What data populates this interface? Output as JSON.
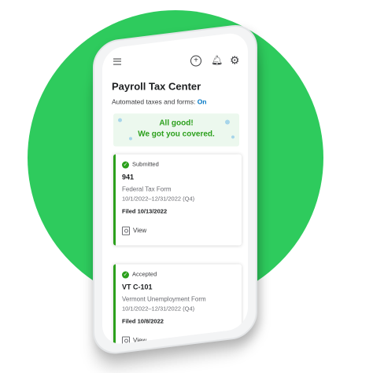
{
  "header": {
    "menu_icon": "menu-icon",
    "add_icon": "plus-circle-icon",
    "bell_icon": "bell-icon",
    "settings_icon": "gear-icon"
  },
  "page": {
    "title": "Payroll Tax Center",
    "automated_label": "Automated taxes and forms:",
    "automated_status": "On"
  },
  "banner": {
    "line1": "All good!",
    "line2": "We got you covered."
  },
  "forms": [
    {
      "status": "Submitted",
      "form_id": "941",
      "form_name": "Federal Tax Form",
      "period": "10/1/2022–12/31/2022 (Q4)",
      "filed": "Filed 10/13/2022",
      "action": "View"
    },
    {
      "status": "Accepted",
      "form_id": "VT C-101",
      "form_name": "Vermont Unemployment Form",
      "period": "10/1/2022–12/31/2022 (Q4)",
      "filed": "Filed 10/8/2022",
      "action": "View"
    }
  ],
  "colors": {
    "background_circle": "#2ecb5d",
    "accent_green": "#2ca01c",
    "link_blue": "#0077c5"
  }
}
